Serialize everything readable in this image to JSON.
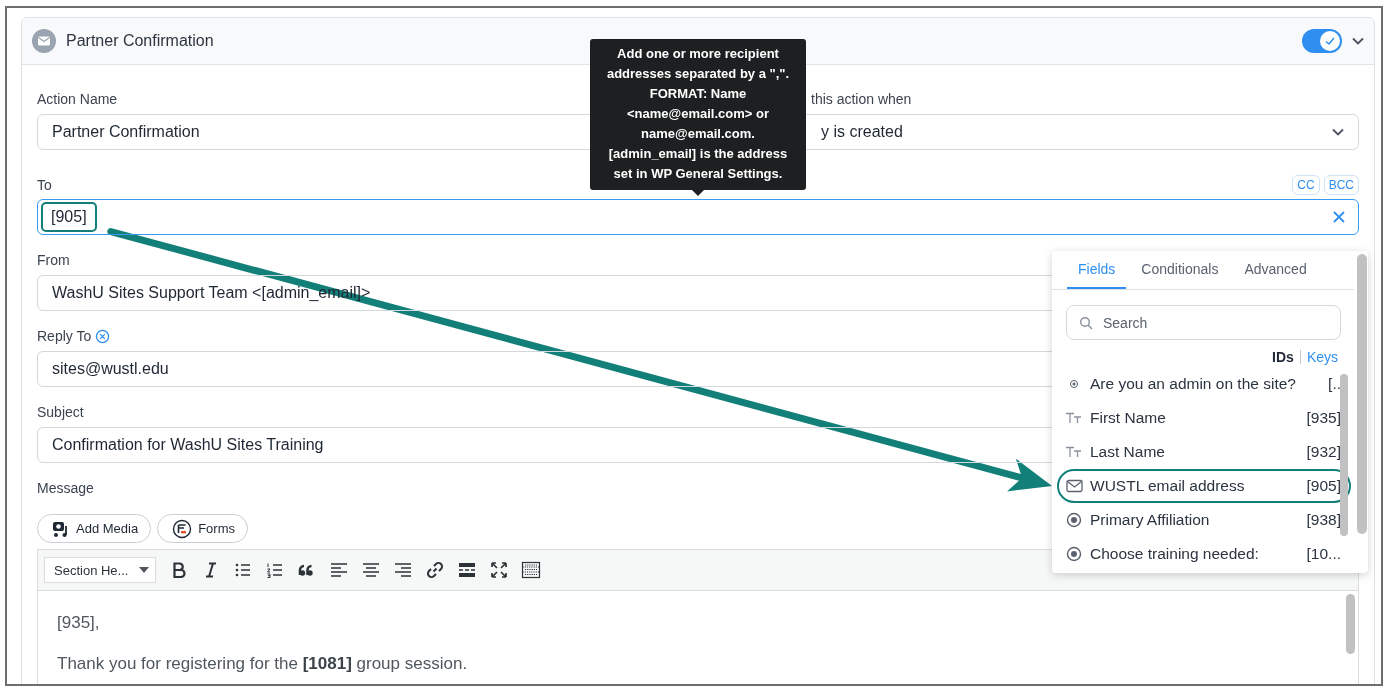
{
  "action": {
    "title": "Partner Confirmation",
    "enabled": true
  },
  "tooltip": {
    "text": "Add one or more recipient addresses separated by a \",\". FORMAT: Name <name@email.com> or name@email.com. [admin_email] is the address set in WP General Settings."
  },
  "fields": [
    {
      "kind": "text",
      "label": "Action Name",
      "value": "Partner Confirmation"
    },
    {
      "kind": "select",
      "label": "this action when",
      "value": "y is created"
    },
    {
      "kind": "recipients",
      "label": "To",
      "chips": [
        {
          "text": "[905]",
          "annotated": true
        }
      ],
      "buttons": [
        "CC",
        "BCC"
      ]
    },
    {
      "kind": "text",
      "label": "From",
      "value": "WashU Sites Support Team <[admin_email]>"
    },
    {
      "kind": "text",
      "label": "Reply To",
      "value": "sites@wustl.edu",
      "removable": true
    },
    {
      "kind": "text",
      "label": "Subject",
      "value": "Confirmation for WashU Sites Training"
    }
  ],
  "message": {
    "label": "Message",
    "media_buttons": [
      {
        "kind": "media",
        "label": "Add Media"
      },
      {
        "kind": "forms",
        "label": "Forms"
      }
    ],
    "format": "Section He...",
    "paragraphs": [
      "[935],",
      "Thank you for registering for the **[1081]** group session."
    ]
  },
  "field_picker": {
    "tabs": [
      {
        "label": "Fields",
        "selected": true
      },
      {
        "label": "Conditionals",
        "selected": false
      },
      {
        "label": "Advanced",
        "selected": false
      }
    ],
    "search": {
      "placeholder": "Search"
    },
    "id_modes": [
      {
        "label": "IDs",
        "selected": true
      },
      {
        "label": "Keys",
        "selected": false
      }
    ],
    "items": [
      {
        "kind": "radio-small",
        "label": "Are you an admin on the site?",
        "id": "[..",
        "annotated": false
      },
      {
        "kind": "text",
        "label": "First Name",
        "id": "[935]",
        "annotated": false
      },
      {
        "kind": "text",
        "label": "Last Name",
        "id": "[932]",
        "annotated": false
      },
      {
        "kind": "email",
        "label": "WUSTL email address",
        "id": "[905]",
        "annotated": true
      },
      {
        "kind": "radio",
        "label": "Primary Affiliation",
        "id": "[938]",
        "annotated": false
      },
      {
        "kind": "radio",
        "label": "Choose training needed:",
        "id": "[10...",
        "annotated": false
      }
    ]
  }
}
